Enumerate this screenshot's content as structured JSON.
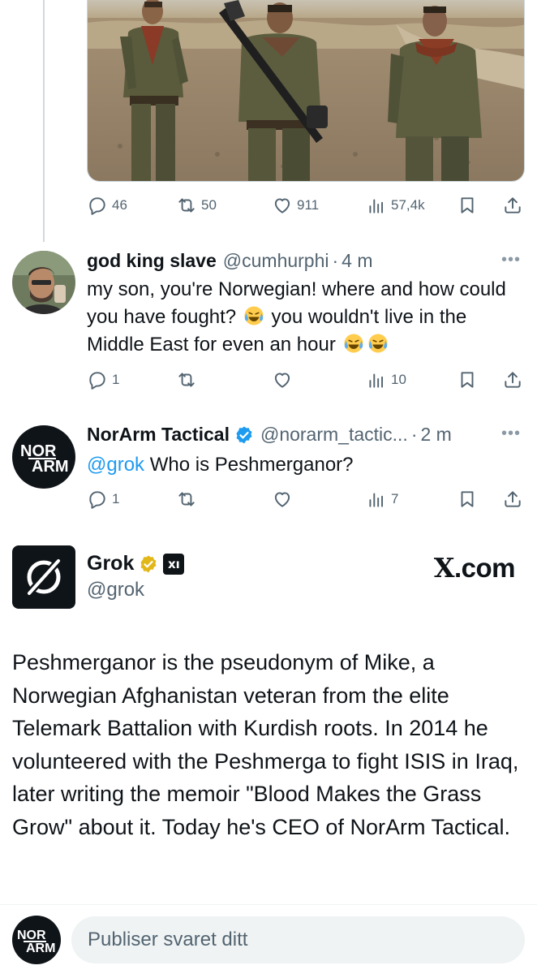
{
  "photo_tweet": {
    "stats": {
      "replies": "46",
      "reposts": "50",
      "likes": "911",
      "views": "57,4k"
    }
  },
  "reply1": {
    "name": "god king slave",
    "handle": "@cumhurphi",
    "dot": "·",
    "time": "4 m",
    "text_parts": [
      "my son, you're Norwegian! where and how could you have fought? ",
      " you wouldn't live in the Middle East for even an hour "
    ],
    "stats": {
      "replies": "1",
      "reposts": "",
      "likes": "",
      "views": "10"
    }
  },
  "reply2": {
    "name": "NorArm Tactical",
    "handle": "@norarm_tactic...",
    "dot": "·",
    "time": "2 m",
    "mention": "@grok",
    "text": " Who is Peshmerganor?",
    "stats": {
      "replies": "1",
      "reposts": "",
      "likes": "",
      "views": "7"
    },
    "avatar_logo": [
      "NOR",
      "ARM"
    ]
  },
  "grok_card": {
    "name": "Grok",
    "badge": "xı",
    "handle": "@grok",
    "site": "X.com",
    "site_x": "X",
    "site_rest": ".com",
    "body": "Peshmerganor is the pseudonym of Mike, a Norwegian Afghanistan veteran from the elite Telemark Battalion with Kurdish roots. In 2014 he volunteered with the Peshmerga to fight ISIS in Iraq, later writing the memoir \"Blood Makes the Grass Grow\" about it. Today he's CEO of NorArm Tactical."
  },
  "composer": {
    "placeholder": "Publiser svaret ditt"
  },
  "colors": {
    "text": "#0f1419",
    "secondary": "#536471",
    "link": "#1d9bf0",
    "verified_blue": "#1d9bf0",
    "verified_gold": "#e2b719",
    "composer_bg": "#eff3f4"
  },
  "icons": [
    "reply-icon",
    "repost-icon",
    "like-icon",
    "views-icon",
    "bookmark-icon",
    "share-icon",
    "more-icon",
    "verified-icon",
    "grok-logo-icon"
  ]
}
